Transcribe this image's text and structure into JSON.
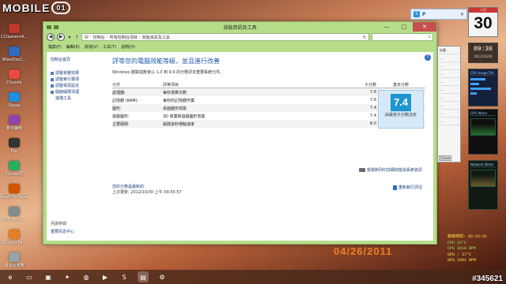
{
  "watermark": {
    "text": "MOBILE",
    "badge": "01"
  },
  "desktop": {
    "icons": [
      {
        "label": "CCleanerv4...",
        "color": "#c0392b"
      },
      {
        "label": "WiseDiscC...",
        "color": "#2d6cc0"
      },
      {
        "label": "Chuzzle",
        "color": "#e74c3c"
      },
      {
        "label": "Skype",
        "color": "#1f8fe0"
      },
      {
        "label": "數字擴散",
        "color": "#8e44ad"
      },
      {
        "label": "Psp",
        "color": "#333333"
      },
      {
        "label": "ConvertZ",
        "color": "#27ae60"
      },
      {
        "label": "Need For Speed T...",
        "color": "#d35400"
      },
      {
        "label": "NFS_TR_+...",
        "color": "#7f8c8d"
      },
      {
        "label": "BurnoutPa...",
        "color": "#e67e22"
      },
      {
        "label": "資源回收筒",
        "color": "#95a5a6"
      }
    ]
  },
  "window": {
    "title": "效能資訊及工具",
    "address": {
      "parts": [
        "控制台",
        "所有控制台項目",
        "效能資訊及工具"
      ]
    },
    "search_icon": "search-icon",
    "menu": [
      "檔案(F)",
      "編輯(E)",
      "檢視(V)",
      "工具(T)",
      "說明(H)"
    ],
    "left_pane": {
      "home": "控制台首頁",
      "links": [
        {
          "label": "調整視覺效果",
          "shield": true
        },
        {
          "label": "調整索引選項",
          "shield": true
        },
        {
          "label": "調整電源設定",
          "shield": true
        },
        {
          "label": "開啟磁碟清理",
          "shield": true
        },
        {
          "label": "進階工具",
          "shield": false
        }
      ],
      "see_also": "另請參閱",
      "action_center": "重要訊息中心"
    },
    "main": {
      "heading": "評等您的電腦效能等級，並且進行改善",
      "subheading": "Windows 體驗指數會以 1.0 到 9.9 的分數評定重要系統元件。",
      "columns": {
        "component": "元件",
        "rated": "評等項目",
        "subscore": "子分數",
        "base": "基本分數"
      },
      "rows": [
        {
          "component": "處理器:",
          "rated": "每秒運算次數",
          "score": "7.6"
        },
        {
          "component": "記憶體 (RAM):",
          "rated": "每秒的記憶體作業",
          "score": "7.6"
        },
        {
          "component": "圖形:",
          "rated": "桌面圖形效能",
          "score": "7.4"
        },
        {
          "component": "遊戲圖形:",
          "rated": "3D 商業和遊戲圖形效能",
          "score": "7.4"
        },
        {
          "component": "主要硬碟:",
          "rated": "磁碟資料傳輸速率",
          "score": "8.0"
        }
      ],
      "base_score": "7.4",
      "base_caption": "由最低子分數決定",
      "detail_link": "檢視和列印詳細效能與系統資訊",
      "note_label": "您的分數是最新的",
      "last_update": "上次更新: 2012/10/30 上午 09:55:57",
      "rerun_link": "重新執行評估"
    }
  },
  "gadgets": {
    "calendar_month": "十月",
    "calendar_day": "30",
    "clock_time": "09:36",
    "clock_date": "2012/10/30",
    "cpu_title": "CPU Usage 5%",
    "gpu_title": "GPU Meter",
    "net_title": "Network Meter"
  },
  "notification": {
    "icon": "S",
    "label": "P",
    "close": "✕"
  },
  "side_app": {
    "rows": [
      "訪客...",
      "...",
      "...",
      "...",
      "...",
      "...",
      "...",
      "...",
      "...",
      "..."
    ],
    "button": "Chase"
  },
  "hud": {
    "time": "錄像時間: 02:15:51",
    "cpu_temp": "CPU 33°C",
    "cpu_fan": "CPU 1018 RPM",
    "gpu_temp": "GPU : 37°C",
    "gpu_fan": "GPU 1881 RPM"
  },
  "photo_date": "04/26/2011",
  "taskbar": {
    "apps": [
      {
        "icon": "ie-icon",
        "glyph": "e"
      },
      {
        "icon": "explorer-icon",
        "glyph": "▭"
      },
      {
        "icon": "save-icon",
        "glyph": "▣"
      },
      {
        "icon": "tool-icon",
        "glyph": "✦"
      },
      {
        "icon": "game-icon",
        "glyph": "◍"
      },
      {
        "icon": "media-icon",
        "glyph": "▶"
      },
      {
        "icon": "skype-icon",
        "glyph": "S"
      },
      {
        "icon": "photo-icon",
        "glyph": "▤"
      },
      {
        "icon": "settings-icon",
        "glyph": "⚙"
      }
    ],
    "post_id": "#345621"
  },
  "colors": {
    "window_frame": "#b6dd8a",
    "link": "#1c3f7a",
    "heading": "#1f5aa6",
    "score_tile": "#1e95cf",
    "close_button": "#c74f4f"
  }
}
